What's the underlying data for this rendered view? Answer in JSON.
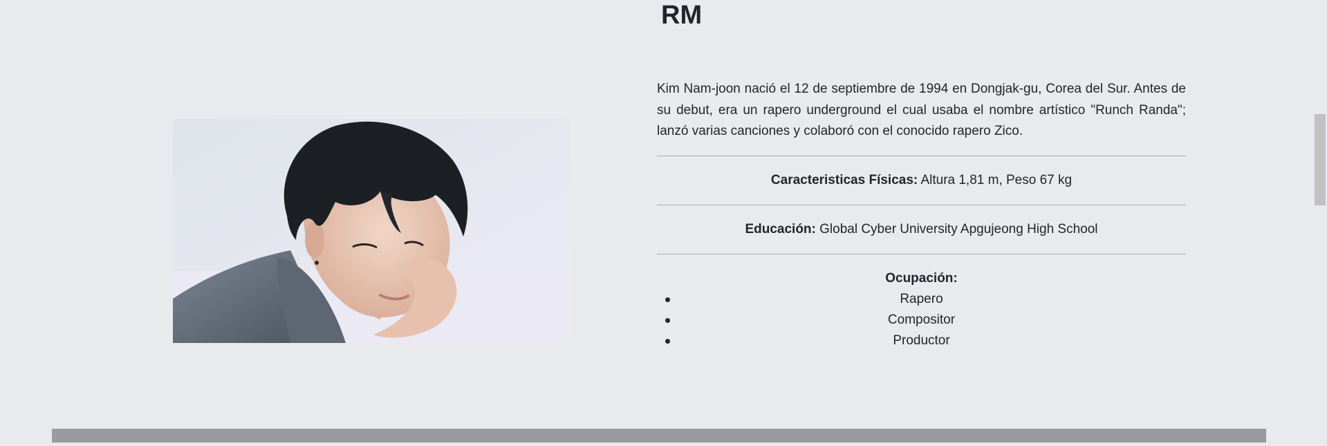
{
  "member": {
    "name": "RM",
    "bio": "Kim Nam-joon nació el 12 de septiembre de 1994 en Dongjak-gu, Corea del Sur. Antes de su debut, era un rapero underground el cual usaba el nombre artístico \"Runch Randa\"; lanzó varias canciones y colaboró con el conocido rapero Zico.",
    "physical_label": "Caracteristicas Físicas:",
    "physical_value": " Altura 1,81 m, Peso 67 kg",
    "education_label": "Educación:",
    "education_value": " Global Cyber University Apgujeong High School",
    "occupation_label": "Ocupación:",
    "occupations": [
      "Rapero",
      "Compositor",
      "Productor"
    ]
  },
  "colors": {
    "background": "#e9eaed",
    "text": "#212529",
    "footer_bar": "#9a9b9e",
    "scrollbar_thumb": "#c1c1c1"
  }
}
